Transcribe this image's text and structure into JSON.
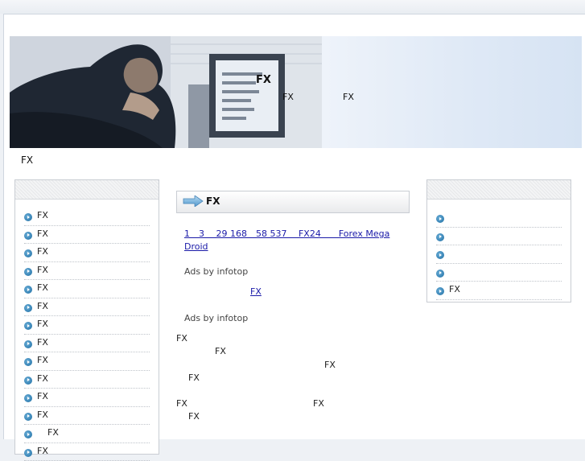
{
  "header": {
    "title": "FX",
    "sub1": "FX",
    "sub2": "FX",
    "description": "FX"
  },
  "left_nav": {
    "items": [
      "FX",
      "FX",
      "FX",
      "FX",
      "FX",
      "FX",
      "FX",
      "FX",
      "FX",
      "FX",
      "FX",
      "FX",
      "FX",
      "FX"
    ]
  },
  "main": {
    "heading": "FX",
    "ad_link_1": "1　3　 29  168　58  537　 FX24　　Forex Mega Droid",
    "ads_by_1": "Ads by infotop",
    "ad_link_2": "FX",
    "ads_by_2": "Ads by infotop",
    "para_1": "FX",
    "para_2": "FX",
    "para_3": "FX",
    "para_4": "FX",
    "para_5": "FX",
    "para_6": "FX",
    "para_7": "FX"
  },
  "right_nav": {
    "items": [
      "",
      "",
      "",
      "",
      "FX"
    ]
  },
  "colors": {
    "link": "#1a1aa8",
    "bullet": "#3a86b8",
    "banner_end": "#d6e3f3"
  },
  "icons": {
    "bullet": "circle-arrow-bullet-icon",
    "heading": "blue-arrow-icon"
  }
}
